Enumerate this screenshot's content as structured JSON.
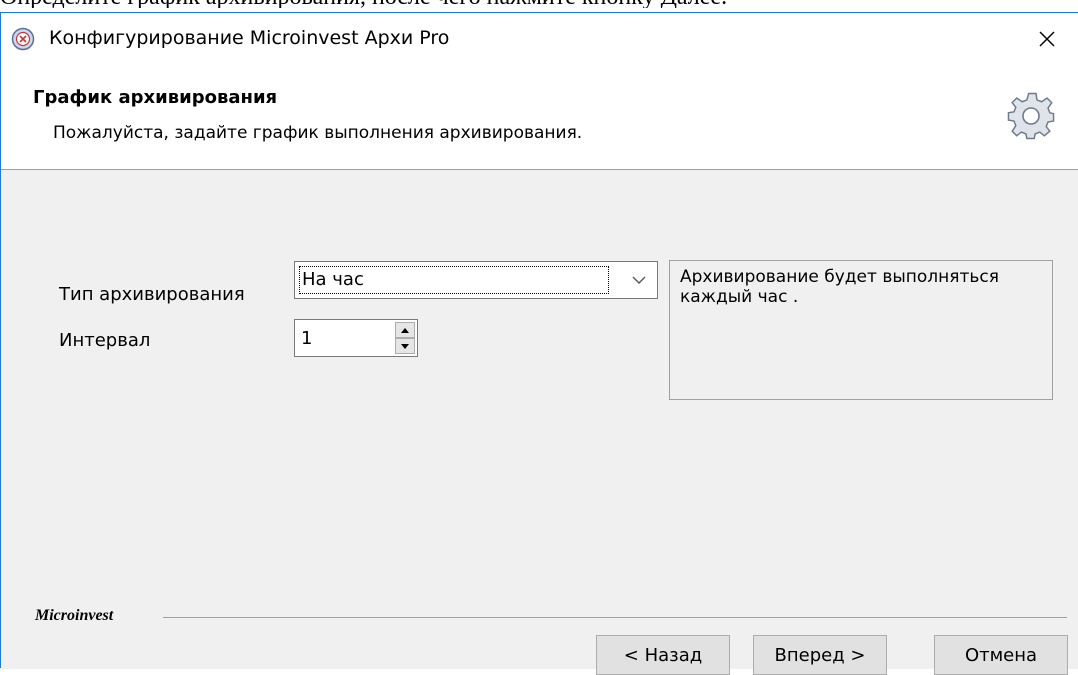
{
  "doc_text": "Определите график архивирования, после чего нажмите кнопку Далее.",
  "window": {
    "title": "Конфигурирование Microinvest Архи Pro",
    "close_icon": "close-icon"
  },
  "header": {
    "title": "График архивирования",
    "subtitle": "Пожалуйста, задайте график выполнения архивирования.",
    "icon": "gear-icon"
  },
  "form": {
    "archive_type_label": "Тип архивирования",
    "archive_type_value": "На час",
    "interval_label": "Интервал",
    "interval_value": "1",
    "description": "Архивирование будет выполняться каждый час ."
  },
  "footer": {
    "brand": "Microinvest",
    "back_label": "< Назад",
    "next_label": "Вперед >",
    "cancel_label": "Отмена"
  },
  "colors": {
    "window_border": "#1e7ad8",
    "body_bg": "#f0f0f0",
    "button_bg": "#e1e1e1"
  }
}
